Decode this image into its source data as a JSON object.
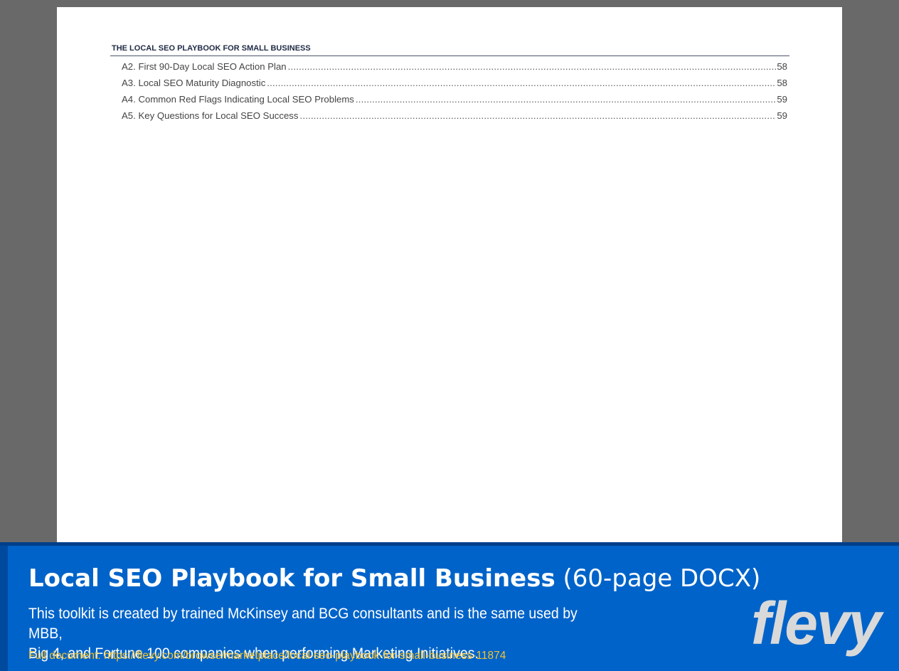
{
  "document": {
    "running_header": "THE LOCAL SEO PLAYBOOK FOR SMALL BUSINESS",
    "toc": [
      {
        "title": "A2. First 90-Day Local SEO Action Plan",
        "page": "58"
      },
      {
        "title": "A3. Local SEO Maturity Diagnostic",
        "page": "58"
      },
      {
        "title": "A4. Common Red Flags Indicating Local SEO Problems",
        "page": "59"
      },
      {
        "title": "A5. Key Questions for Local SEO Success",
        "page": "59"
      }
    ]
  },
  "banner": {
    "title": "Local SEO Playbook for Small Business",
    "subtitle": "(60-page DOCX)",
    "description_line1": "This toolkit is created by trained McKinsey and BCG consultants and is the same used by MBB,",
    "description_line2": "Big 4, and Fortune 100 companies when performing Marketing Initiatives.",
    "link_text": "Full document: https://flevy.com/browse/marketplace/local-seo-playbook-for-small-business-11874",
    "logo_text": "flevy"
  },
  "colors": {
    "viewer_background": "#696969",
    "banner_blue": "#0063c9",
    "link_yellow": "#f2c230",
    "logo_gray": "#d9d9d9",
    "header_navy": "#1f2a44"
  }
}
